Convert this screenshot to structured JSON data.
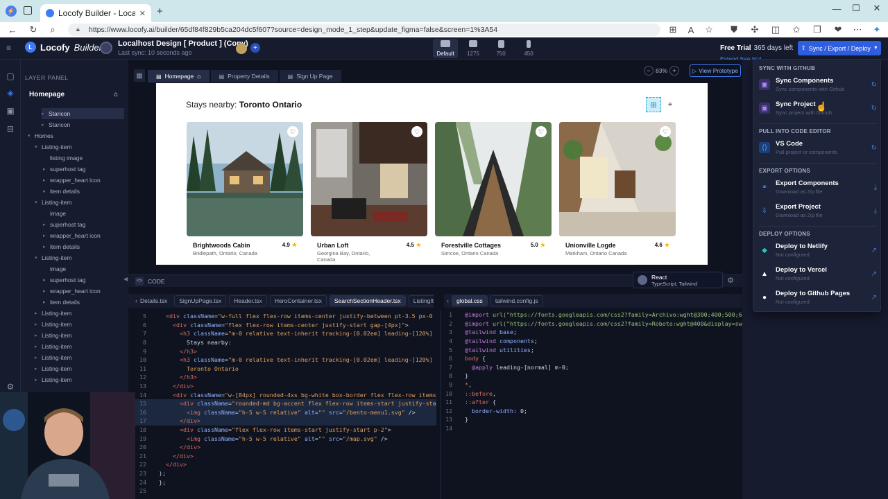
{
  "browser": {
    "tab_title": "Locofy Builder - Localhost Design",
    "url": "https://www.locofy.ai/builder/65df84f829b5ca204dc5f607?source=design_mode_1_step&update_figma=false&screen=1%3A54"
  },
  "header": {
    "logo": "Locofy",
    "logo_sub": "Builder",
    "project_title": "Localhost Design [ Product ] (Copy)",
    "last_sync": "Last sync: 10 seconds ago",
    "devices": [
      {
        "label": "Default"
      },
      {
        "label": "1275"
      },
      {
        "label": "750"
      },
      {
        "label": "450"
      }
    ],
    "trial_label": "Free Trial",
    "trial_days": "365 days left",
    "extend": "Extend free trial",
    "sync_button": "Sync / Export / Deploy"
  },
  "layer_panel": {
    "title": "LAYER PANEL",
    "home": "Homepage",
    "layers": [
      "Staricon",
      "Staricon",
      "Homes",
      "Listing-item",
      "listing image",
      "superhost tag",
      "wrapper_heart icon",
      "item details",
      "Listing-item",
      "image",
      "superhost tag",
      "wrapper_heart icon",
      "item details",
      "Listing-item",
      "image",
      "superhost tag",
      "wrapper_heart icon",
      "item details",
      "Listing-item",
      "Listing-item",
      "Listing-item",
      "Listing-item",
      "Listing-item",
      "Listing-item",
      "Listing-item"
    ]
  },
  "canvas": {
    "page_tabs": [
      "Homepage",
      "Property Details",
      "Sign Up Page"
    ],
    "zoom": "83%",
    "view_prototype": "View Prototype",
    "stays_label": "Stays nearby:",
    "stays_city": "Toronto Ontario",
    "listings": [
      {
        "name": "Brightwoods Cabin",
        "location": "Bridlepath, Ontario, Canada",
        "rating": "4.9"
      },
      {
        "name": "Urban Loft",
        "location": "Georgina Bay, Ontario, Canada",
        "rating": "4.5"
      },
      {
        "name": "Forestville Cottages",
        "location": "Simcoe, Ontario Canada",
        "rating": "5.0"
      },
      {
        "name": "Unionville Logde",
        "location": "Markham, Ontario Canada",
        "rating": "4.6"
      }
    ]
  },
  "code": {
    "panel_title": "CODE",
    "framework": "React",
    "framework_sub": "TypeScript, Tailwind",
    "file_tabs": [
      "Details.tsx",
      "SignUpPage.tsx",
      "Header.tsx",
      "HeroContainer.tsx",
      "SearchSectionHeader.tsx",
      "ListingItem.tsx"
    ],
    "active_file": "SearchSectionHeader.tsx",
    "css_tabs": [
      "global.css",
      "tailwind.config.js"
    ]
  },
  "dropdown": {
    "sec_github": "SYNC WITH GITHUB",
    "sync_components": "Sync Components",
    "sync_components_sub": "Sync components with Github",
    "sync_project": "Sync Project",
    "sync_project_sub": "Sync project with Github",
    "sec_editor": "PULL INTO CODE EDITOR",
    "vscode": "VS Code",
    "vscode_sub": "Pull project or components",
    "sec_export": "EXPORT OPTIONS",
    "export_components": "Export Components",
    "export_components_sub": "Download as Zip file",
    "export_project": "Export Project",
    "export_project_sub": "Download as Zip file",
    "sec_deploy": "DEPLOY OPTIONS",
    "netlify": "Deploy to Netlify",
    "netlify_sub": "Not configured",
    "vercel": "Deploy to Vercel",
    "vercel_sub": "Not configured",
    "ghpages": "Deploy to Github Pages",
    "ghpages_sub": "Not configured"
  }
}
